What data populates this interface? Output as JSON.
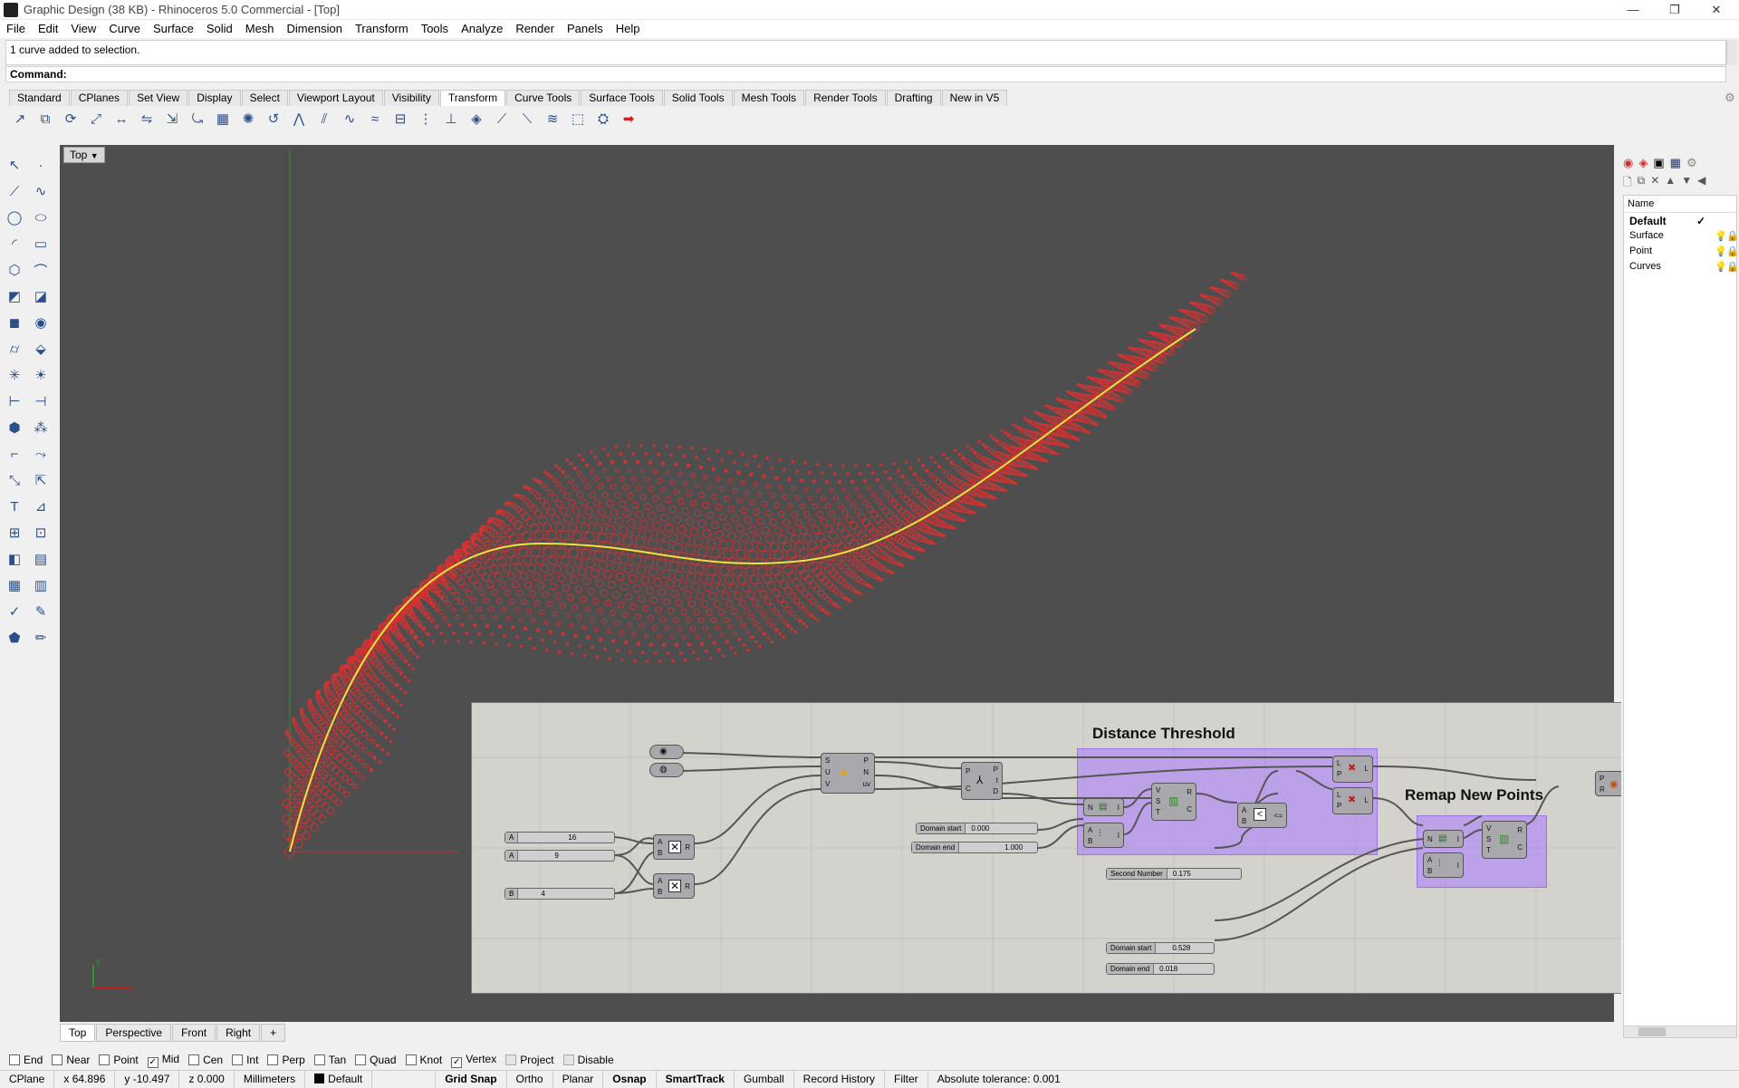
{
  "window": {
    "title": "Graphic Design (38 KB) - Rhinoceros 5.0 Commercial - [Top]",
    "minimize": "—",
    "restore": "❐",
    "close": "✕"
  },
  "menu": [
    "File",
    "Edit",
    "View",
    "Curve",
    "Surface",
    "Solid",
    "Mesh",
    "Dimension",
    "Transform",
    "Tools",
    "Analyze",
    "Render",
    "Panels",
    "Help"
  ],
  "command_history": "1 curve added to selection.",
  "command_prompt": "Command:",
  "toolbar_tabs": [
    "Standard",
    "CPlanes",
    "Set View",
    "Display",
    "Select",
    "Viewport Layout",
    "Visibility",
    "Transform",
    "Curve Tools",
    "Surface Tools",
    "Solid Tools",
    "Mesh Tools",
    "Render Tools",
    "Drafting",
    "New in V5"
  ],
  "active_toolbar_tab": "Transform",
  "viewport": {
    "label": "Top",
    "tabs": [
      "Top",
      "Perspective",
      "Front",
      "Right"
    ],
    "add_tab": "+",
    "axis_y": "y",
    "axis_x": "x"
  },
  "grasshopper": {
    "group1_title": "Distance Threshold",
    "group2_title": "Remap New Points",
    "sliders": {
      "a16": {
        "label": "A",
        "value": "16"
      },
      "a9": {
        "label": "A",
        "value": "9"
      },
      "b4": {
        "label": "B",
        "value": "4"
      },
      "domain_start1": {
        "label": "Domain start",
        "value": "0.000"
      },
      "domain_end1": {
        "label": "Domain end",
        "value": "1.000"
      },
      "second_number": {
        "label": "Second Number",
        "value": "0.175"
      },
      "domain_start2": {
        "label": "Domain start",
        "value": "0.528"
      },
      "domain_end2": {
        "label": "Domain end",
        "value": "0.018"
      }
    }
  },
  "layers": {
    "header": "Name",
    "rows": [
      {
        "name": "Default",
        "current": true,
        "mark": "✓"
      },
      {
        "name": "Surface"
      },
      {
        "name": "Point"
      },
      {
        "name": "Curves"
      }
    ]
  },
  "osnaps": [
    {
      "label": "End",
      "checked": false
    },
    {
      "label": "Near",
      "checked": false
    },
    {
      "label": "Point",
      "checked": false
    },
    {
      "label": "Mid",
      "checked": true
    },
    {
      "label": "Cen",
      "checked": false
    },
    {
      "label": "Int",
      "checked": false
    },
    {
      "label": "Perp",
      "checked": false
    },
    {
      "label": "Tan",
      "checked": false
    },
    {
      "label": "Quad",
      "checked": false
    },
    {
      "label": "Knot",
      "checked": false
    },
    {
      "label": "Vertex",
      "checked": true
    },
    {
      "label": "Project",
      "checked": false
    },
    {
      "label": "Disable",
      "checked": false
    }
  ],
  "status": {
    "cplane": "CPlane",
    "x": "x 64.896",
    "y": "y -10.497",
    "z": "z 0.000",
    "units": "Millimeters",
    "layer": "Default",
    "grid_snap": "Grid Snap",
    "ortho": "Ortho",
    "planar": "Planar",
    "osnap": "Osnap",
    "smarttrack": "SmartTrack",
    "gumball": "Gumball",
    "record_history": "Record History",
    "filter": "Filter",
    "tolerance": "Absolute tolerance: 0.001"
  },
  "colors": {
    "curve": "#f5e23a",
    "dots": "#e03030",
    "group": "#aa78ff"
  }
}
